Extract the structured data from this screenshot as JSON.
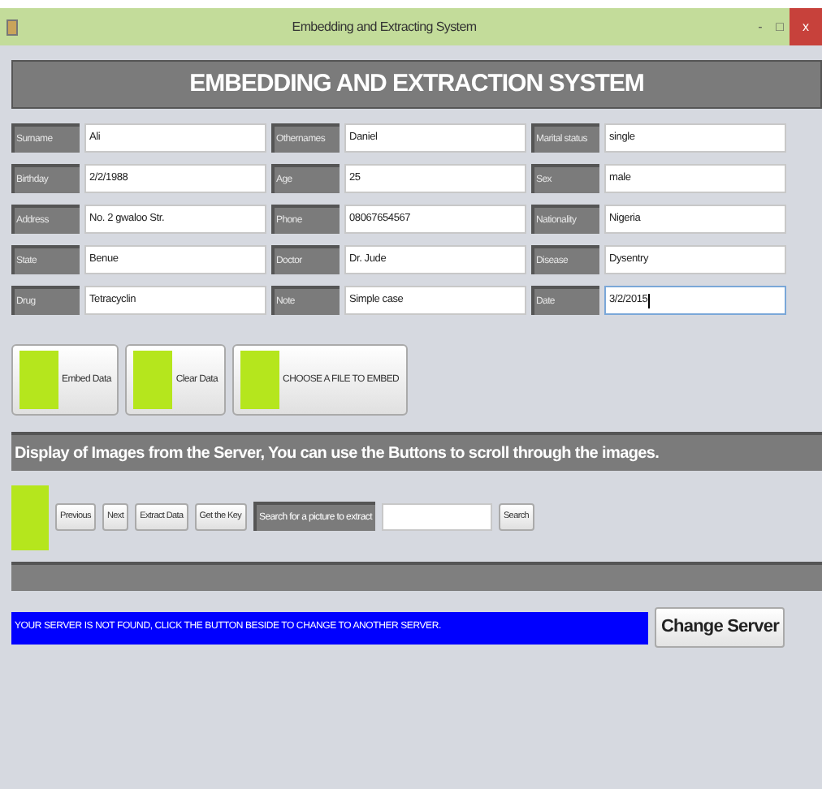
{
  "window": {
    "title": "Embedding and Extracting System",
    "controls": [
      "-",
      "□",
      "x"
    ]
  },
  "header": {
    "title": "EMBEDDING AND EXTRACTION SYSTEM"
  },
  "form": {
    "fields": [
      {
        "label": "Surname",
        "value": "Ali",
        "focused": false
      },
      {
        "label": "Othernames",
        "value": "Daniel",
        "focused": false
      },
      {
        "label": "Marital status",
        "value": "single",
        "focused": false
      },
      {
        "label": "Birthday",
        "value": "2/2/1988",
        "focused": false
      },
      {
        "label": "Age",
        "value": "25",
        "focused": false
      },
      {
        "label": "Sex",
        "value": "male",
        "focused": false
      },
      {
        "label": "Address",
        "value": "No. 2 gwaloo Str.",
        "focused": false
      },
      {
        "label": "Phone",
        "value": "08067654567",
        "focused": false
      },
      {
        "label": "Nationality",
        "value": "Nigeria",
        "focused": false
      },
      {
        "label": "State",
        "value": "Benue",
        "focused": false
      },
      {
        "label": "Doctor",
        "value": "Dr. Jude",
        "focused": false
      },
      {
        "label": "Disease",
        "value": "Dysentry",
        "focused": false
      },
      {
        "label": "Drug",
        "value": "Tetracyclin",
        "focused": false
      },
      {
        "label": "Note",
        "value": "Simple case",
        "focused": false
      },
      {
        "label": "Date",
        "value": "3/2/2015",
        "focused": true
      }
    ]
  },
  "action_buttons": [
    {
      "label": "Embed Data"
    },
    {
      "label": "Clear Data"
    },
    {
      "label": "CHOOSE A FILE TO EMBED"
    }
  ],
  "display_banner": {
    "text": "Display of Images from the Server, You can use the Buttons to scroll through the images."
  },
  "image_toolbar": [
    {
      "kind": "button",
      "text": "Previous"
    },
    {
      "kind": "button",
      "text": "Next"
    },
    {
      "kind": "button",
      "text": "Extract Data"
    },
    {
      "kind": "button",
      "text": "Get the Key"
    },
    {
      "kind": "label",
      "text": "Search for a picture to extract"
    },
    {
      "kind": "input"
    },
    {
      "kind": "button",
      "text": "Search"
    }
  ],
  "server": {
    "message": "YOUR SERVER IS NOT FOUND, CLICK THE BUTTON BESIDE TO CHANGE TO ANOTHER SERVER.",
    "button": "Change Server"
  }
}
